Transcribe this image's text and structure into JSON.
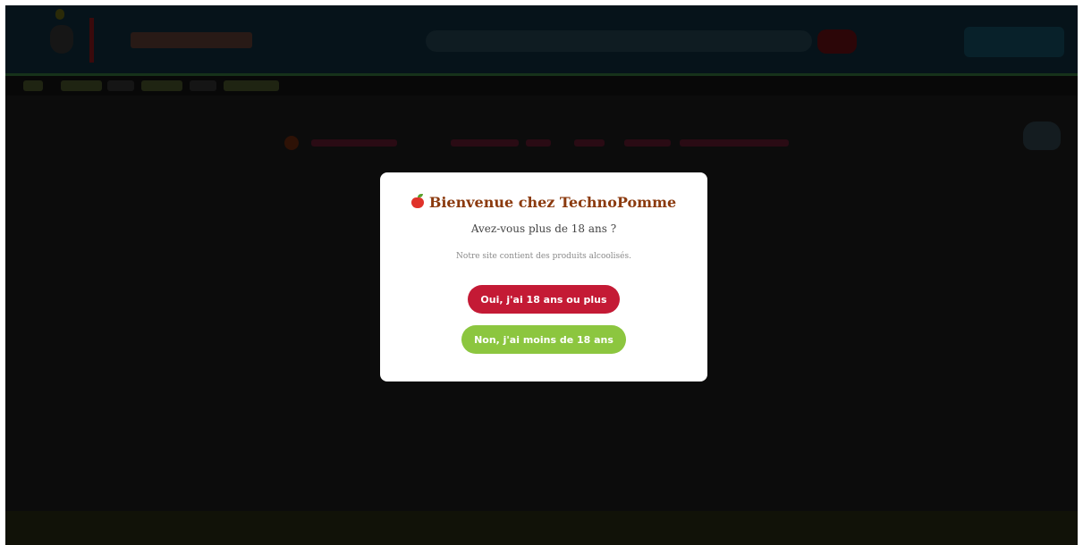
{
  "modal": {
    "title": "Bienvenue chez TechnoPomme",
    "title_icon": "apple-icon",
    "question": "Avez-vous plus de 18 ans ?",
    "note": "Notre site contient des produits alcoolisés.",
    "yes_label": "Oui, j'ai 18 ans ou plus",
    "no_label": "Non, j'ai moins de 18 ans"
  },
  "colors": {
    "title": "#8b3a0e",
    "yes_button": "#c41a35",
    "no_button": "#8cc63f",
    "overlay": "#0c0c0c"
  }
}
